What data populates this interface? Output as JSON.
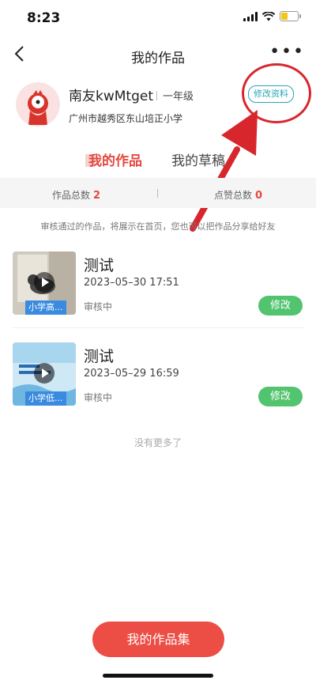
{
  "status_bar": {
    "time": "8:23"
  },
  "nav": {
    "title": "我的作品",
    "more": "•••"
  },
  "profile": {
    "name": "南友kwMtget",
    "grade": "一年级",
    "school": "广州市越秀区东山培正小学",
    "edit_label": "修改资料"
  },
  "tabs": [
    {
      "label": "我的作品"
    },
    {
      "label": "我的草稿"
    }
  ],
  "stats": {
    "works_label": "作品总数",
    "works_count": "2",
    "likes_label": "点赞总数",
    "likes_count": "0"
  },
  "notice": "审核通过的作品，将展示在首页，您也可以把作品分享给好友",
  "works": [
    {
      "title": "测试",
      "date": "2023–05–30 17:51",
      "status": "审核中",
      "tag": "小学高...",
      "edit": "修改"
    },
    {
      "title": "测试",
      "date": "2023–05–29 16:59",
      "status": "审核中",
      "tag": "小学低...",
      "edit": "修改"
    }
  ],
  "no_more": "没有更多了",
  "collection_button": "我的作品集",
  "colors": {
    "accent_red": "#ec4d45",
    "edit_green": "#52c36e",
    "edit_profile_blue": "#2aa5b8",
    "annotation_red": "#d8262d"
  }
}
